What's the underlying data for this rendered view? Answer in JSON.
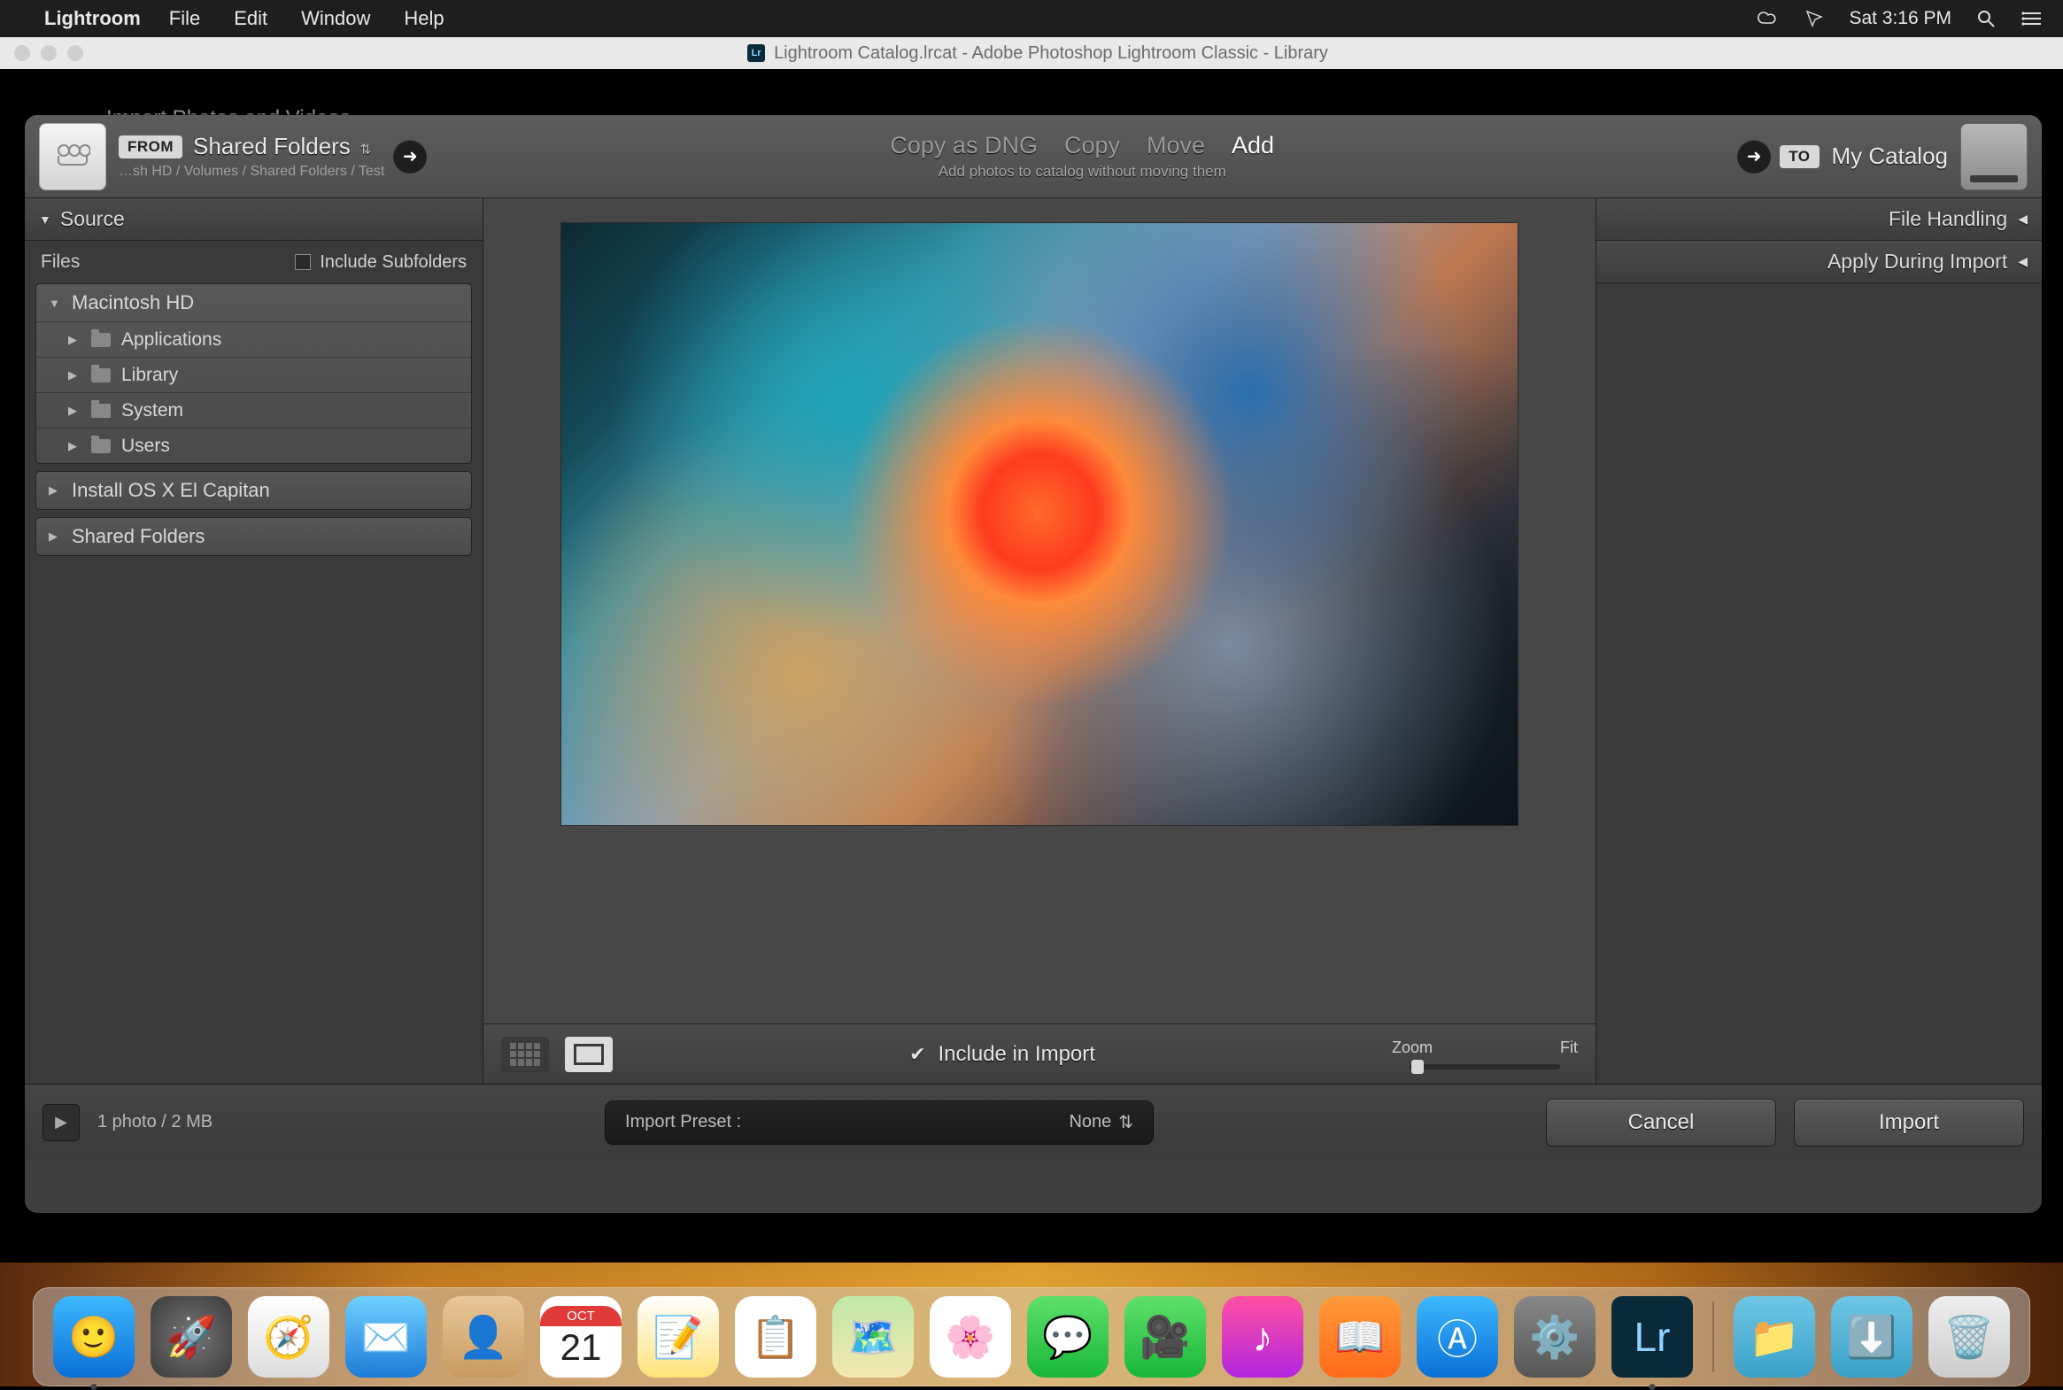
{
  "menubar": {
    "app": "Lightroom",
    "items": [
      "File",
      "Edit",
      "Window",
      "Help"
    ],
    "clock": "Sat 3:16 PM"
  },
  "window": {
    "title": "Lightroom Catalog.lrcat - Adobe Photoshop Lightroom Classic - Library",
    "hidden_label": "Import Photos and Videos"
  },
  "top": {
    "from_badge": "FROM",
    "from_title": "Shared Folders",
    "from_path": "…sh HD / Volumes / Shared Folders / Test",
    "modes": {
      "dng": "Copy as DNG",
      "copy": "Copy",
      "move": "Move",
      "add": "Add"
    },
    "mode_sub": "Add photos to catalog without moving them",
    "to_badge": "TO",
    "to_title": "My Catalog"
  },
  "left": {
    "source": "Source",
    "files": "Files",
    "include_sub": "Include Subfolders",
    "nodes": {
      "mac": "Macintosh HD",
      "children": [
        "Applications",
        "Library",
        "System",
        "Users"
      ],
      "install": "Install OS X El Capitan",
      "shared": "Shared Folders"
    }
  },
  "right": {
    "file_handling": "File Handling",
    "apply": "Apply During Import"
  },
  "center": {
    "include": "Include in Import",
    "zoom": "Zoom",
    "fit": "Fit"
  },
  "bottom": {
    "count": "1 photo / 2 MB",
    "preset_label": "Import Preset :",
    "preset_value": "None",
    "cancel": "Cancel",
    "import": "Import"
  },
  "dock": {
    "cal_month": "OCT",
    "cal_day": "21",
    "lr": "Lr"
  }
}
